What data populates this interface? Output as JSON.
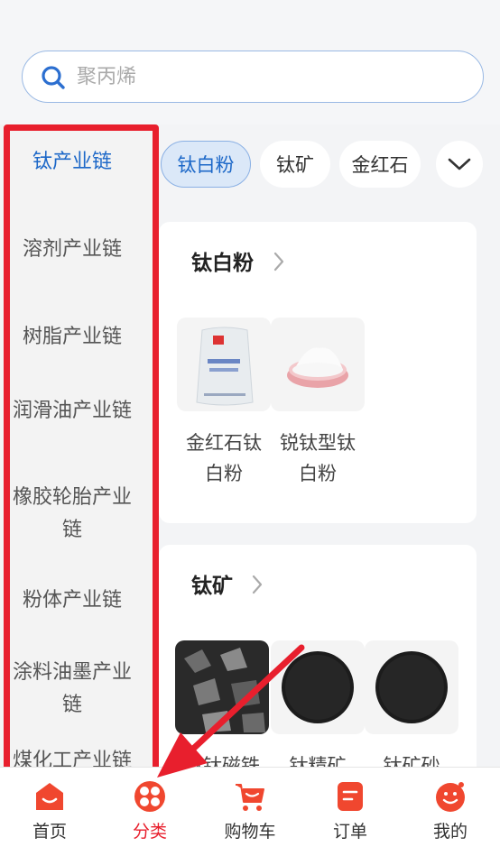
{
  "search": {
    "placeholder": "聚丙烯"
  },
  "sidebar": {
    "items": [
      {
        "label": "钛产业链",
        "active": true
      },
      {
        "label": "溶剂产业链"
      },
      {
        "label": "树脂产业链"
      },
      {
        "label": "润滑油产业链"
      },
      {
        "label": "橡胶轮胎产业链"
      },
      {
        "label": "粉体产业链"
      },
      {
        "label": "涂料油墨产业链"
      },
      {
        "label": "煤化工产业链"
      }
    ]
  },
  "chips": [
    {
      "label": "钛白粉",
      "active": true
    },
    {
      "label": "钛矿"
    },
    {
      "label": "金红石"
    }
  ],
  "sections": [
    {
      "title": "钛白粉",
      "products": [
        {
          "name": "金红石钛白粉",
          "icon": "white-powder-bag"
        },
        {
          "name": "锐钛型钛白粉",
          "icon": "white-powder-dish"
        }
      ]
    },
    {
      "title": "钛矿",
      "products": [
        {
          "name": "钒钛磁铁",
          "icon": "dark-ore"
        },
        {
          "name": "钛精矿",
          "icon": "black-sand"
        },
        {
          "name": "钛矿砂",
          "icon": "black-sand"
        }
      ]
    }
  ],
  "tabbar": [
    {
      "label": "首页",
      "icon": "home-icon"
    },
    {
      "label": "分类",
      "icon": "category-icon",
      "active": true
    },
    {
      "label": "购物车",
      "icon": "cart-icon"
    },
    {
      "label": "订单",
      "icon": "order-icon"
    },
    {
      "label": "我的",
      "icon": "profile-icon"
    }
  ],
  "colors": {
    "accent": "#1d68c8",
    "brand": "#e81f2d",
    "annotation": "#e81f2d"
  }
}
